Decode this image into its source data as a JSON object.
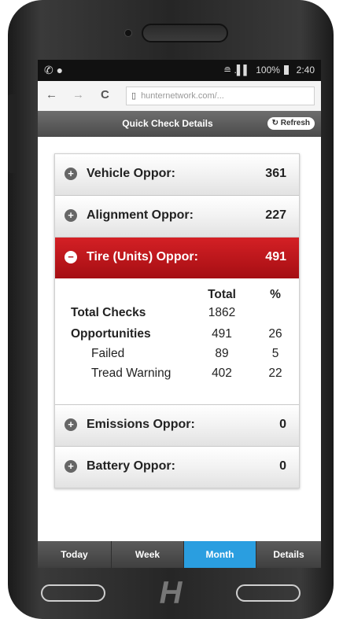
{
  "status_bar": {
    "left_icons": "✆ ●",
    "signal": "≘ .▌▌",
    "battery_percent": "100%",
    "time": "2:40"
  },
  "browser": {
    "back_icon": "←",
    "forward_icon": "→",
    "reload_icon": "C",
    "url": "hunternetwork.com/..."
  },
  "header": {
    "title": "Quick Check Details",
    "refresh_label": "↻ Refresh"
  },
  "categories": [
    {
      "label": "Vehicle Oppor:",
      "value": "361",
      "icon": "plus-circle-icon",
      "symbol": "+"
    },
    {
      "label": "Alignment Oppor:",
      "value": "227",
      "icon": "plus-circle-icon",
      "symbol": "+"
    },
    {
      "label": "Tire (Units) Oppor:",
      "value": "491",
      "icon": "minus-circle-icon",
      "symbol": "−"
    },
    {
      "label": "Emissions Oppor:",
      "value": "0",
      "icon": "plus-circle-icon",
      "symbol": "+"
    },
    {
      "label": "Battery Oppor:",
      "value": "0",
      "icon": "plus-circle-icon",
      "symbol": "+"
    }
  ],
  "tire_details": {
    "columns": {
      "total": "Total",
      "percent": "%"
    },
    "rows": [
      {
        "name": "Total Checks",
        "total": "1862",
        "percent": ""
      },
      {
        "name": "Opportunities",
        "total": "491",
        "percent": "26"
      },
      {
        "name": "Failed",
        "total": "89",
        "percent": "5"
      },
      {
        "name": "Tread Warning",
        "total": "402",
        "percent": "22"
      }
    ]
  },
  "tabs": [
    {
      "label": "Today",
      "selected": false
    },
    {
      "label": "Week",
      "selected": false
    },
    {
      "label": "Month",
      "selected": true
    },
    {
      "label": "Details",
      "selected": false
    }
  ],
  "brand": {
    "home_logo": "H"
  },
  "colors": {
    "active_row": "#c4151b",
    "selected_tab": "#2a9ee0",
    "header": "#555555"
  }
}
